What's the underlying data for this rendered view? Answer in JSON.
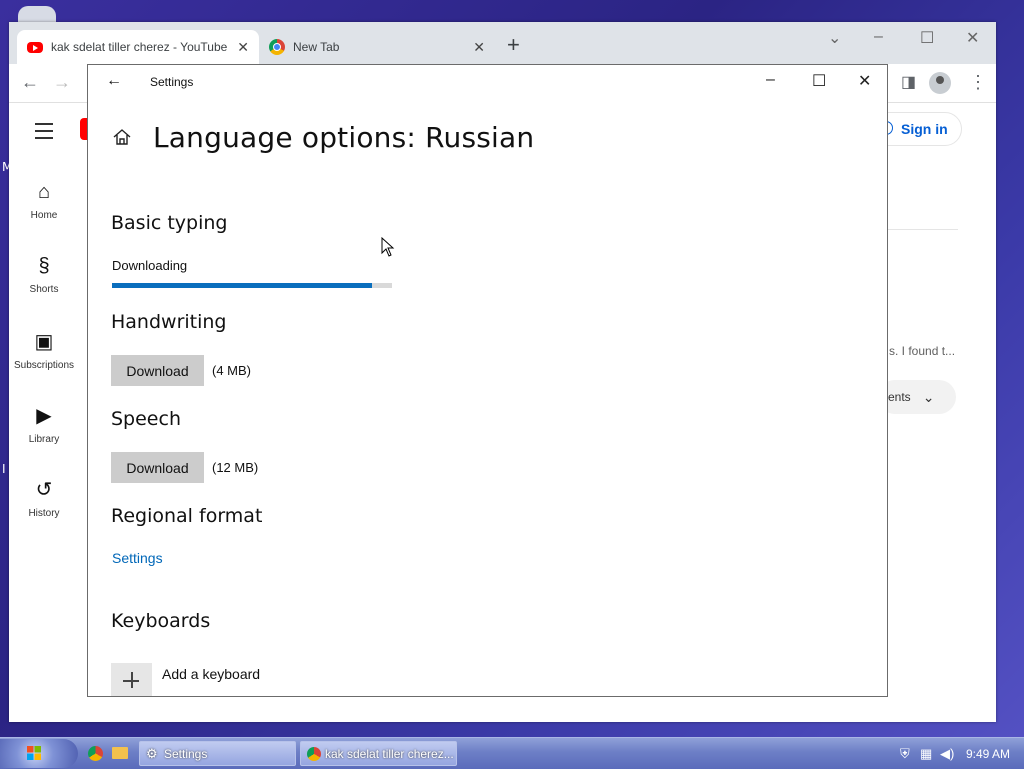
{
  "browser": {
    "tabs": [
      {
        "title": "kak sdelat tiller cherez - YouTube",
        "active": true,
        "favicon": "youtube-icon"
      },
      {
        "title": "New Tab",
        "active": false,
        "favicon": "chrome-icon"
      }
    ]
  },
  "youtube": {
    "sidebar": [
      {
        "label": "Home",
        "icon": "home-icon"
      },
      {
        "label": "Shorts",
        "icon": "shorts-icon"
      },
      {
        "label": "Subscriptions",
        "icon": "subscriptions-icon"
      },
      {
        "label": "Library",
        "icon": "library-icon"
      },
      {
        "label": "History",
        "icon": "history-icon"
      }
    ],
    "sign_in": "Sign in",
    "snippet": "s. I found t...",
    "chip_label": "ents"
  },
  "settings": {
    "window_title": "Settings",
    "heading": "Language options: Russian",
    "basic_typing": {
      "title": "Basic typing",
      "status": "Downloading",
      "progress": 0.93
    },
    "handwriting": {
      "title": "Handwriting",
      "button": "Download",
      "size": "(4 MB)"
    },
    "speech": {
      "title": "Speech",
      "button": "Download",
      "size": "(12 MB)"
    },
    "regional_format": {
      "title": "Regional format",
      "link": "Settings"
    },
    "keyboards": {
      "title": "Keyboards",
      "add_label": "Add a keyboard"
    }
  },
  "taskbar": {
    "buttons": [
      {
        "label": "Settings",
        "icon": "gear-icon"
      },
      {
        "label": "kak sdelat tiller cherez...",
        "icon": "chrome-icon"
      }
    ],
    "clock": "9:49 AM"
  },
  "colors": {
    "accent": "#0067b8",
    "progress": "#0a6ebd",
    "youtube_red": "#ff0000",
    "signin_blue": "#065fd4"
  }
}
